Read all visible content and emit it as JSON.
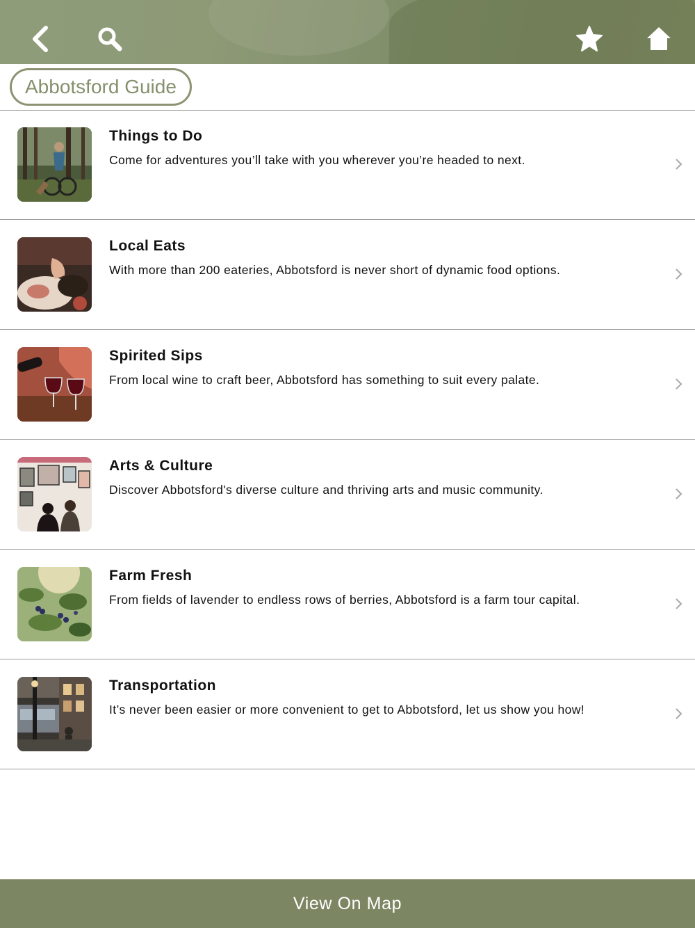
{
  "header": {
    "icons": [
      "back-icon",
      "search-icon",
      "star-icon",
      "home-icon"
    ]
  },
  "guide": {
    "title": "Abbotsford Guide"
  },
  "items": [
    {
      "title": "Things to Do",
      "desc": "Come for adventures you’ll take with you wherever you’re headed to next."
    },
    {
      "title": "Local Eats",
      "desc": "With more than 200 eateries, Abbotsford is never short of dynamic food options."
    },
    {
      "title": "Spirited Sips",
      "desc": "From local wine to craft beer, Abbotsford has something to suit every palate."
    },
    {
      "title": "Arts & Culture",
      "desc": "Discover Abbotsford's diverse culture and thriving arts and music community."
    },
    {
      "title": "Farm Fresh",
      "desc": "From fields of lavender to endless rows of berries, Abbotsford is a farm tour capital."
    },
    {
      "title": "Transportation",
      "desc": "It’s never been easier or more convenient to get to Abbotsford, let us show you how!"
    }
  ],
  "footer": {
    "label": "View On Map"
  },
  "colors": {
    "header": "#7d8663",
    "accent": "#85906c",
    "divider": "#9a9a9a"
  }
}
